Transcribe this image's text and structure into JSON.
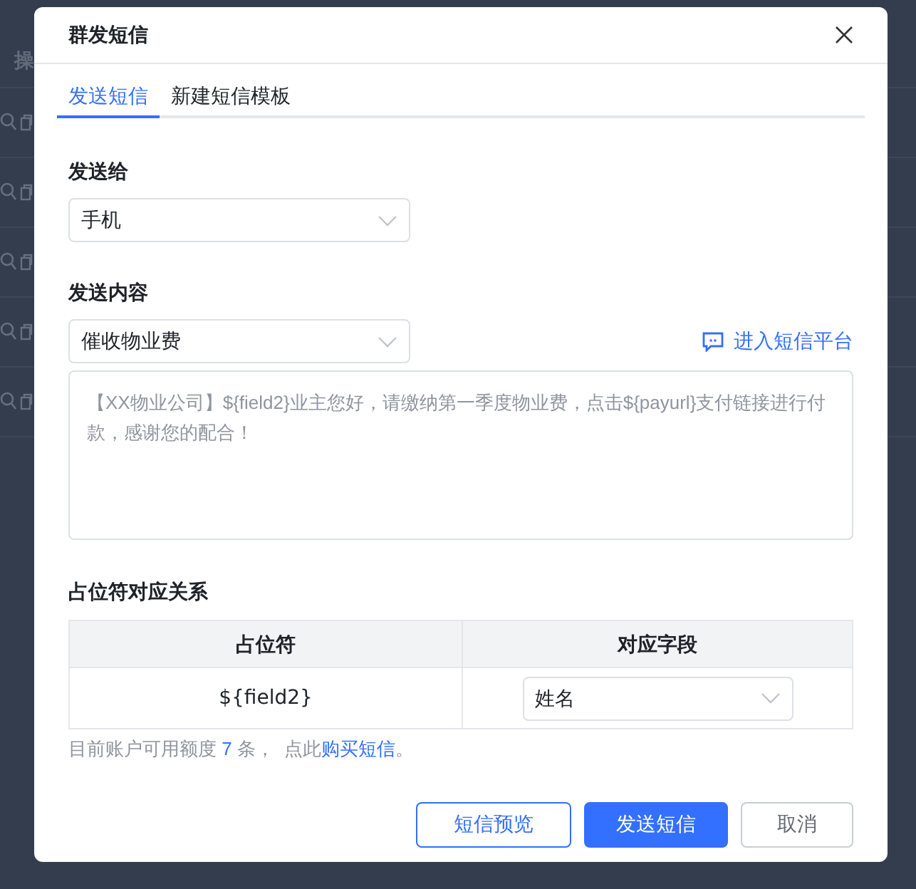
{
  "background": {
    "column_header": "操"
  },
  "dialog": {
    "title": "群发短信",
    "tabs": [
      {
        "label": "发送短信",
        "selected": true
      },
      {
        "label": "新建短信模板",
        "selected": false
      }
    ],
    "send_to": {
      "label": "发送给",
      "value": "手机"
    },
    "content": {
      "label": "发送内容",
      "value": "催收物业费",
      "platform_link": "进入短信平台",
      "message": "【XX物业公司】${field2}业主您好，请缴纳第一季度物业费，点击${payurl}支付链接进行付款，感谢您的配合！"
    },
    "mapping": {
      "label": "占位符对应关系",
      "columns": [
        "占位符",
        "对应字段"
      ],
      "rows": [
        {
          "placeholder": "${field2}",
          "field": "姓名"
        }
      ]
    },
    "quota": {
      "prefix": "目前账户可用额度",
      "count": "7",
      "suffix": "条，  点此",
      "link": "购买短信",
      "end": "。"
    },
    "buttons": [
      {
        "label": "短信预览",
        "kind": "outline"
      },
      {
        "label": "发送短信",
        "kind": "primary"
      },
      {
        "label": "取消",
        "kind": "default"
      }
    ]
  }
}
